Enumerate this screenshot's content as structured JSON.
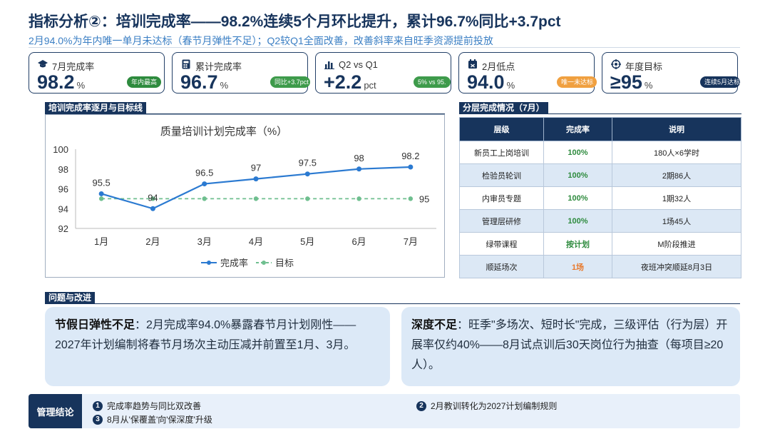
{
  "header": {
    "title": "指标分析②：培训完成率——98.2%连续5个月环比提升，累计96.7%同比+3.7pct",
    "subtitle": "2月94.0%为年内唯一单月未达标（春节月弹性不足）；Q2较Q1全面改善，改善斜率来自旺季资源提前投放"
  },
  "kpis": [
    {
      "icon": "graduation-cap-icon",
      "label": "7月完成率",
      "value": "98.2",
      "unit": "%",
      "tag": "年内最高",
      "tag_color": "#2e8b3e"
    },
    {
      "icon": "calculator-icon",
      "label": "累计完成率",
      "value": "96.7",
      "unit": "%",
      "tag": "同比+3.7pct",
      "tag_color": "#3e9b4b"
    },
    {
      "icon": "bar-chart-icon",
      "label": "Q2 vs Q1",
      "value": "+2.2",
      "unit": "pct",
      "tag": "5% vs 95.",
      "tag_color": "#3e9b4b"
    },
    {
      "icon": "calendar-icon",
      "label": "2月低点",
      "value": "94.0",
      "unit": "%",
      "tag": "唯一未达标",
      "tag_color": "#f0a040"
    },
    {
      "icon": "target-icon",
      "label": "年度目标",
      "value": "≥95",
      "unit": "%",
      "tag": "连续5月达标",
      "tag_color": "#17345c"
    }
  ],
  "sections": {
    "chart_label": "培训完成率逐月与目标线",
    "table_label": "分层完成情况（7月）",
    "issues_label": "问题与改进"
  },
  "chart_data": {
    "type": "line",
    "title": "质量培训计划完成率（%）",
    "categories": [
      "1月",
      "2月",
      "3月",
      "4月",
      "5月",
      "6月",
      "7月"
    ],
    "series": [
      {
        "name": "完成率",
        "values": [
          95.5,
          94,
          96.5,
          97,
          97.5,
          98,
          98.2
        ],
        "color": "#2b7ad1",
        "style": "solid"
      },
      {
        "name": "目标",
        "values": [
          95,
          95,
          95,
          95,
          95,
          95,
          95
        ],
        "color": "#6fbf8f",
        "style": "dashed"
      }
    ],
    "data_labels": [
      "95.5",
      "94",
      "96.5",
      "97",
      "97.5",
      "98",
      "98.2"
    ],
    "target_label": "95",
    "ylim": [
      92,
      100
    ],
    "yticks": [
      "92",
      "94",
      "96",
      "98",
      "100"
    ],
    "legend_position": "bottom",
    "grid": false
  },
  "layer_table": {
    "headers": [
      "层级",
      "完成率",
      "说明"
    ],
    "rows": [
      {
        "level": "新员工上岗培训",
        "rate": "100%",
        "note": "180人×6学时",
        "warn": false
      },
      {
        "level": "检验员轮训",
        "rate": "100%",
        "note": "2期86人",
        "warn": false
      },
      {
        "level": "内审员专题",
        "rate": "100%",
        "note": "1期32人",
        "warn": false
      },
      {
        "level": "管理层研修",
        "rate": "100%",
        "note": "1场45人",
        "warn": false
      },
      {
        "level": "绿带课程",
        "rate": "按计划",
        "note": "M阶段推进",
        "warn": false
      },
      {
        "level": "顺延场次",
        "rate": "1场",
        "note": "夜班冲突顺延8月3日",
        "warn": true
      }
    ]
  },
  "issues": [
    {
      "head": "节假日弹性不足",
      "body": "：2月完成率94.0%暴露春节月计划刚性——2027年计划编制将春节月场次主动压减并前置至1月、3月。"
    },
    {
      "head": "深度不足",
      "body": "：旺季\"多场次、短时长\"完成，三级评估（行为层）开展率仅约40%——8月试点训后30天岗位行为抽查（每项目≥20人）。"
    }
  ],
  "conclusion": {
    "label": "管理结论",
    "items": [
      {
        "num": "1",
        "text": "完成率趋势与同比双改善"
      },
      {
        "num": "2",
        "text": "2月教训转化为2027计划编制规则"
      },
      {
        "num": "3",
        "text": "8月从'保覆盖'向'保深度'升级"
      }
    ]
  }
}
